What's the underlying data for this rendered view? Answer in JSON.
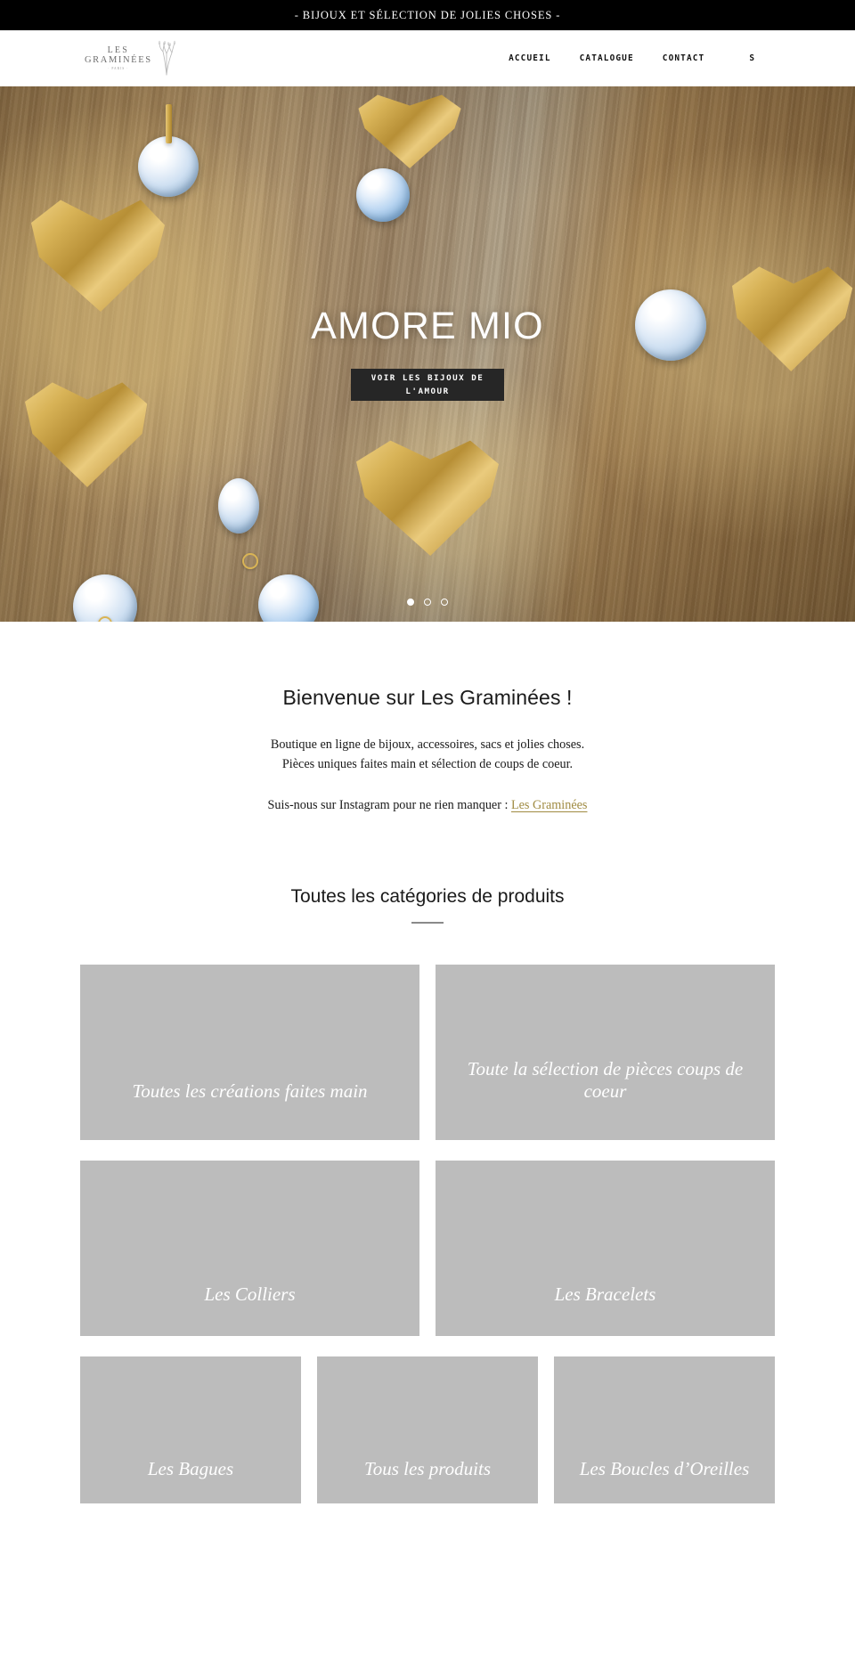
{
  "announcement": {
    "text": "- BIJOUX ET SÉLECTION DE JOLIES CHOSES -"
  },
  "header": {
    "logo": {
      "line1": "LES",
      "line2": "GRAMINÉES",
      "sub": "· PARIS ·",
      "mark_icon": "grass-sprig-icon"
    },
    "nav": [
      {
        "label": "ACCUEIL"
      },
      {
        "label": "CATALOGUE"
      },
      {
        "label": "CONTACT"
      }
    ],
    "extra_label": "S"
  },
  "hero": {
    "title": "AMORE MIO",
    "cta_label": "VOIR LES BIJOUX DE L'AMOUR",
    "slides_total": 3,
    "active_slide": 1,
    "image_alt": "Boucles d'oreilles coeur doré et perles sur planche de bois"
  },
  "welcome": {
    "title": "Bienvenue sur Les Graminées !",
    "line1": "Boutique en ligne de bijoux, accessoires, sacs et jolies choses.",
    "line2": "Pièces uniques faites main et sélection de coups de coeur.",
    "instagram_prefix": "Suis-nous sur Instagram pour ne rien manquer : ",
    "instagram_link": "Les Graminées"
  },
  "categories": {
    "heading": "Toutes les catégories de produits",
    "rows": [
      [
        {
          "label": "Toutes les créations faites main"
        },
        {
          "label": "Toute la sélection de pièces coups de coeur"
        }
      ],
      [
        {
          "label": "Les Colliers"
        },
        {
          "label": "Les Bracelets"
        }
      ],
      [
        {
          "label": "Les Bagues"
        },
        {
          "label": "Tous les produits"
        },
        {
          "label": "Les Boucles d’Oreilles"
        }
      ]
    ]
  },
  "colors": {
    "announcement_bg": "#000000",
    "accent_link": "#a08b42",
    "cta_bg": "#262626",
    "card_placeholder": "#bcbcbc"
  }
}
